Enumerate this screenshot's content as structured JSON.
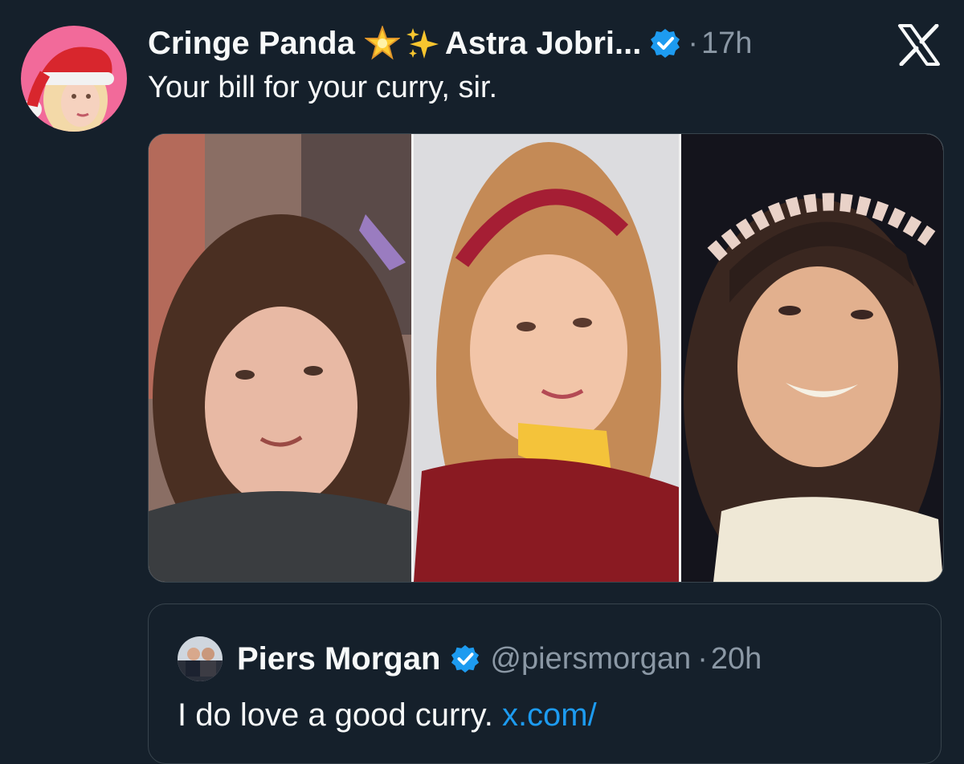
{
  "post": {
    "author_name": "Cringe Panda",
    "display_suffix": "Astra Jobri...",
    "dot": "·",
    "time": "17h",
    "text": "Your bill for your curry, sir.",
    "avatar_icon": "santa-hat-avatar",
    "badge_color": "#1d9bf0"
  },
  "media": {
    "photo_count": 3
  },
  "quoted": {
    "author_name": "Piers Morgan",
    "handle": "@piersmorgan",
    "dot": "·",
    "time": "20h",
    "text": "I do love a good curry.",
    "link": "x.com/"
  },
  "colors": {
    "background": "#15202b",
    "text": "#f7f9f9",
    "muted": "#8b98a5",
    "accent": "#1d9bf0",
    "border": "#38444d"
  }
}
